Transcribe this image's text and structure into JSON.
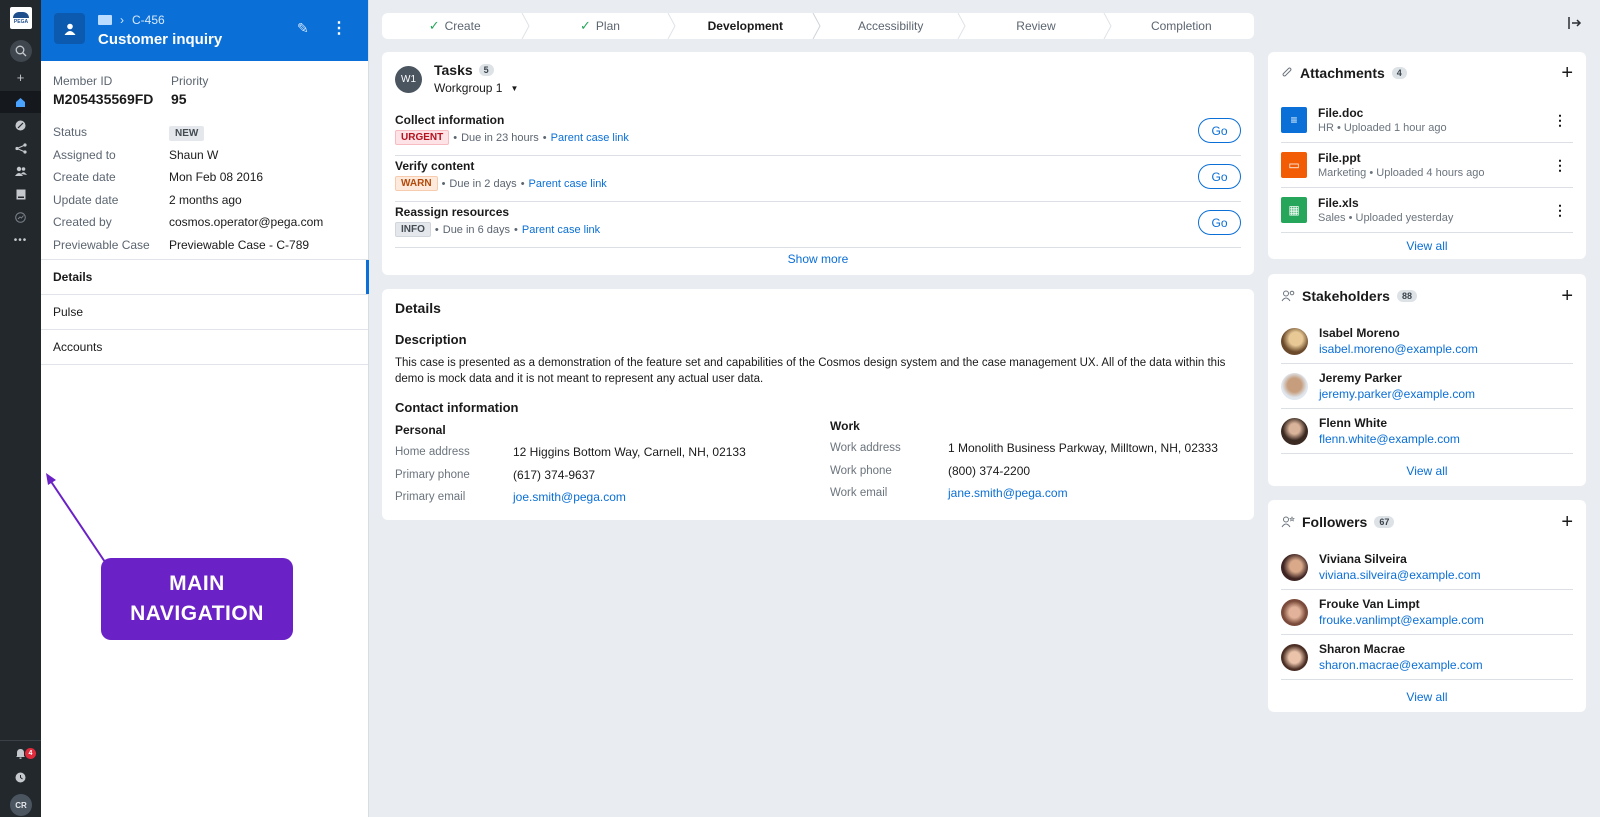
{
  "rail": {
    "logo_text": "PEGA",
    "notification_count": "4",
    "user_initials": "CR",
    "items": [
      {
        "icon": "search-icon"
      },
      {
        "icon": "plus-icon"
      },
      {
        "icon": "home-icon"
      },
      {
        "icon": "dashboard-icon"
      },
      {
        "icon": "share-icon"
      },
      {
        "icon": "users-icon"
      },
      {
        "icon": "book-icon"
      },
      {
        "icon": "reports-icon"
      },
      {
        "icon": "more-icon"
      }
    ]
  },
  "case": {
    "breadcrumb_id": "C-456",
    "title": "Customer inquiry",
    "member_id_label": "Member ID",
    "member_id": "M205435569FD",
    "priority_label": "Priority",
    "priority": "95",
    "fields": [
      {
        "label": "Status",
        "value": "NEW",
        "type": "badge"
      },
      {
        "label": "Assigned to",
        "value": "Shaun W"
      },
      {
        "label": "Create date",
        "value": "Mon Feb 08 2016"
      },
      {
        "label": "Update date",
        "value": "2 months ago"
      },
      {
        "label": "Created by",
        "value": "cosmos.operator@pega.com",
        "type": "link"
      },
      {
        "label": "Previewable Case",
        "value": "Previewable Case - C-789",
        "type": "link"
      }
    ],
    "tabs": [
      "Details",
      "Pulse",
      "Accounts"
    ],
    "active_tab": "Details"
  },
  "annotation": {
    "line1": "MAIN",
    "line2": "NAVIGATION",
    "color": "#6a22c6"
  },
  "stages": [
    {
      "label": "Create",
      "done": true
    },
    {
      "label": "Plan",
      "done": true
    },
    {
      "label": "Development",
      "current": true
    },
    {
      "label": "Accessibility"
    },
    {
      "label": "Review"
    },
    {
      "label": "Completion"
    }
  ],
  "tasks": {
    "avatar": "W1",
    "title": "Tasks",
    "count": "5",
    "workgroup": "Workgroup 1",
    "items": [
      {
        "name": "Collect information",
        "tag": "URGENT",
        "tag_type": "urgent",
        "due": "Due in 23 hours",
        "link": "Parent case link",
        "action": "Go"
      },
      {
        "name": "Verify content",
        "tag": "WARN",
        "tag_type": "warn",
        "due": "Due in 2 days",
        "link": "Parent case link",
        "action": "Go"
      },
      {
        "name": "Reassign resources",
        "tag": "INFO",
        "tag_type": "info",
        "due": "Due in 6 days",
        "link": "Parent case link",
        "action": "Go"
      }
    ],
    "show_more": "Show more"
  },
  "details": {
    "title": "Details",
    "description_heading": "Description",
    "description": "This case is presented as a demonstration of the feature set and capabilities of the Cosmos design system and the case management UX. All of the data within this demo is mock data and it is not meant to represent any actual user data.",
    "contact_heading": "Contact information",
    "personal": {
      "heading": "Personal",
      "rows": [
        {
          "label": "Home address",
          "value": "12 Higgins Bottom Way, Carnell, NH, 02133"
        },
        {
          "label": "Primary phone",
          "value": "(617) 374-9637"
        },
        {
          "label": "Primary email",
          "value": "joe.smith@pega.com",
          "type": "link"
        }
      ]
    },
    "work": {
      "heading": "Work",
      "rows": [
        {
          "label": "Work address",
          "value": "1 Monolith Business Parkway, Milltown, NH, 02333"
        },
        {
          "label": "Work phone",
          "value": "(800) 374-2200"
        },
        {
          "label": "Work email",
          "value": "jane.smith@pega.com",
          "type": "link"
        }
      ]
    }
  },
  "attachments": {
    "title": "Attachments",
    "count": "4",
    "items": [
      {
        "name": "File.doc",
        "category": "HR",
        "uploaded": "Uploaded 1 hour ago",
        "type": "doc"
      },
      {
        "name": "File.ppt",
        "category": "Marketing",
        "uploaded": "Uploaded 4 hours ago",
        "type": "ppt"
      },
      {
        "name": "File.xls",
        "category": "Sales",
        "uploaded": "Uploaded yesterday",
        "type": "xls"
      }
    ],
    "view_all": "View all"
  },
  "stakeholders": {
    "title": "Stakeholders",
    "count": "88",
    "items": [
      {
        "name": "Isabel Moreno",
        "email": "isabel.moreno@example.com",
        "color": "#8a6a3a"
      },
      {
        "name": "Jeremy Parker",
        "email": "jeremy.parker@example.com",
        "color": "#a9876a"
      },
      {
        "name": "Flenn White",
        "email": "flenn.white@example.com",
        "color": "#4a3628"
      }
    ],
    "view_all": "View all"
  },
  "followers": {
    "title": "Followers",
    "count": "67",
    "items": [
      {
        "name": "Viviana Silveira",
        "email": "viviana.silveira@example.com",
        "color": "#5a3a3a"
      },
      {
        "name": "Frouke Van Limpt",
        "email": "frouke.vanlimpt@example.com",
        "color": "#8a5a4a"
      },
      {
        "name": "Sharon Macrae",
        "email": "sharon.macrae@example.com",
        "color": "#6a4a3a"
      }
    ],
    "view_all": "View all"
  }
}
